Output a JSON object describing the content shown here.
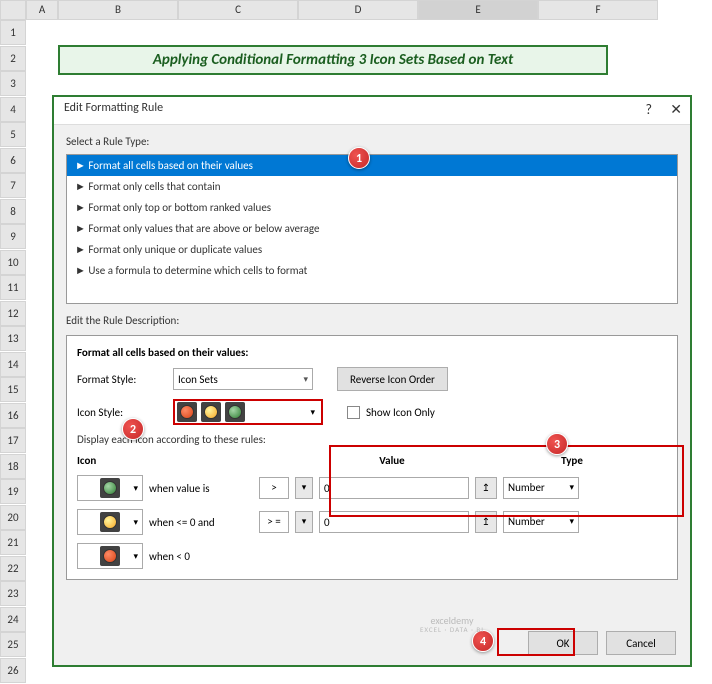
{
  "cols": [
    "A",
    "B",
    "C",
    "D",
    "E",
    "F"
  ],
  "rows": [
    "1",
    "2",
    "3",
    "4",
    "5",
    "6",
    "7",
    "8",
    "9",
    "10",
    "11",
    "12",
    "13",
    "14",
    "15",
    "16",
    "17",
    "18",
    "19",
    "20",
    "21",
    "22",
    "23",
    "24",
    "25",
    "26"
  ],
  "title": "Applying Conditional Formatting 3 Icon Sets Based on Text",
  "dialog": {
    "title": "Edit Formatting Rule",
    "select_label": "Select a Rule Type:",
    "rules": [
      "►  Format all cells based on their values",
      "►  Format only cells that contain",
      "►  Format only top or bottom ranked values",
      "►  Format only values that are above or below average",
      "►  Format only unique or duplicate values",
      "►  Use a formula to determine which cells to format"
    ],
    "desc_label": "Edit the Rule Description:",
    "desc_title": "Format all cells based on their values:",
    "format_style_label": "Format Style:",
    "format_style_value": "Icon Sets",
    "reverse_btn": "Reverse Icon Order",
    "icon_style_label": "Icon Style:",
    "show_icon_only": "Show Icon Only",
    "display_label": "Display each icon according to these rules:",
    "hdr_icon": "Icon",
    "hdr_value": "Value",
    "hdr_type": "Type",
    "when1": "when value is",
    "when2": "when <= 0 and",
    "when3": "when < 0",
    "op1": ">",
    "op2": "> =",
    "val1": "0",
    "val2": "0",
    "type1": "Number",
    "type2": "Number",
    "ok": "OK",
    "cancel": "Cancel"
  },
  "callouts": {
    "c1": "1",
    "c2": "2",
    "c3": "3",
    "c4": "4"
  },
  "watermark": {
    "main": "exceldemy",
    "sub": "EXCEL · DATA · BI"
  }
}
